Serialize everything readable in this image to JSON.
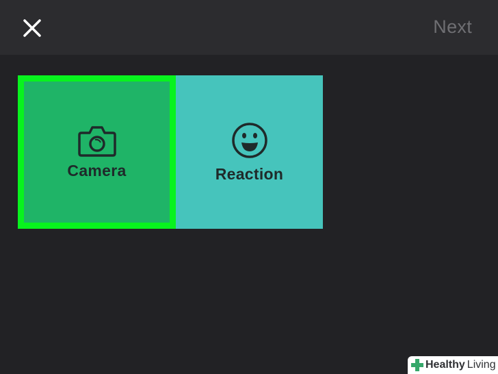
{
  "header": {
    "close_icon": "close-icon",
    "next_label": "Next"
  },
  "tiles": [
    {
      "label": "Camera",
      "icon": "camera-icon",
      "color": "#1fb467",
      "selected": true
    },
    {
      "label": "Reaction",
      "icon": "smiley-icon",
      "color": "#46c4bc",
      "selected": false
    }
  ],
  "highlight_color": "#08f31e",
  "watermark": {
    "brand": "Healthy",
    "sub": "Living"
  }
}
